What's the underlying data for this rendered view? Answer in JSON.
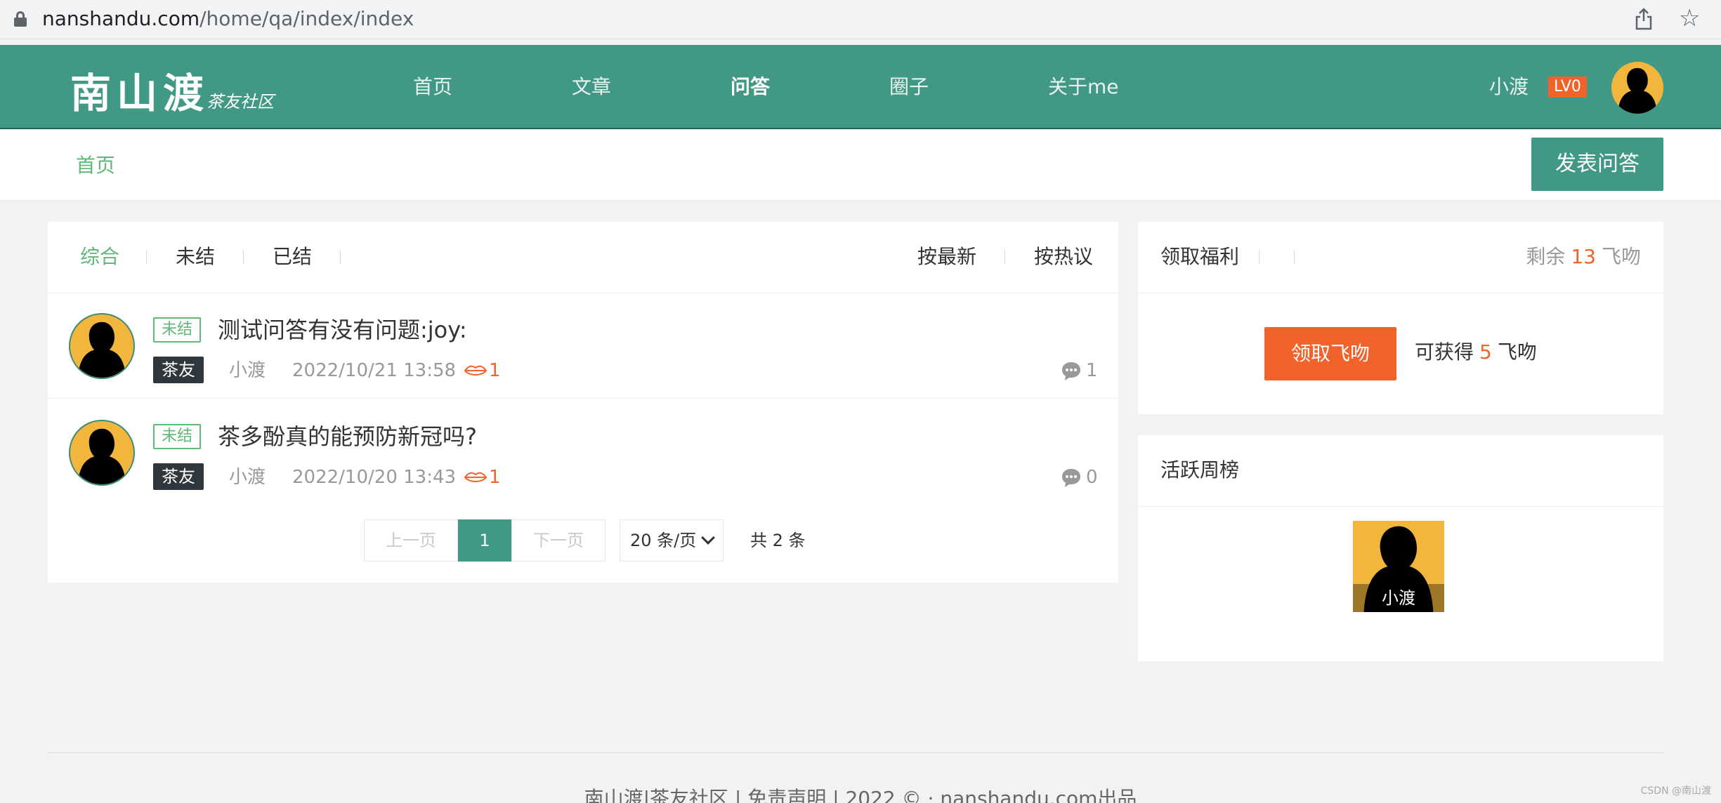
{
  "browser": {
    "url_host": "nanshandu.com",
    "url_path": "/home/qa/index/index"
  },
  "header": {
    "logo_main": "南山渡",
    "logo_sub": "茶友社区",
    "nav": [
      "首页",
      "文章",
      "问答",
      "圈子",
      "关于me"
    ],
    "active_nav": "问答",
    "user_name": "小渡",
    "user_level": "LV0"
  },
  "subbar": {
    "breadcrumb": "首页",
    "post_button": "发表问答"
  },
  "filters": {
    "status_tabs": [
      "综合",
      "未结",
      "已结"
    ],
    "active_status": "综合",
    "sort_tabs": [
      "按最新",
      "按热议"
    ]
  },
  "questions": [
    {
      "status": "未结",
      "title": "测试问答有没有问题:joy:",
      "category": "茶友",
      "author": "小渡",
      "time": "2022/10/21 13:58",
      "kisses": "1",
      "replies": "1"
    },
    {
      "status": "未结",
      "title": "茶多酚真的能预防新冠吗?",
      "category": "茶友",
      "author": "小渡",
      "time": "2022/10/20 13:43",
      "kisses": "1",
      "replies": "0"
    }
  ],
  "pagination": {
    "prev": "上一页",
    "current": "1",
    "next": "下一页",
    "per_page": "20 条/页",
    "total": "共 2 条"
  },
  "welfare": {
    "title": "领取福利",
    "remain_label": "剩余",
    "remain_count": "13",
    "unit": "飞吻",
    "button": "领取飞吻",
    "gain_label": "可获得",
    "gain_count": "5"
  },
  "weekly": {
    "title": "活跃周榜",
    "users": [
      {
        "name": "小渡"
      }
    ]
  },
  "footer": {
    "text": "南山渡|茶友社区 | 免责声明 | 2022 © · nanshandu.com出品",
    "watermark": "CSDN @南山渡"
  },
  "colors": {
    "brand": "#419885",
    "accent": "#f2622b",
    "active_tab": "#5fb878"
  }
}
